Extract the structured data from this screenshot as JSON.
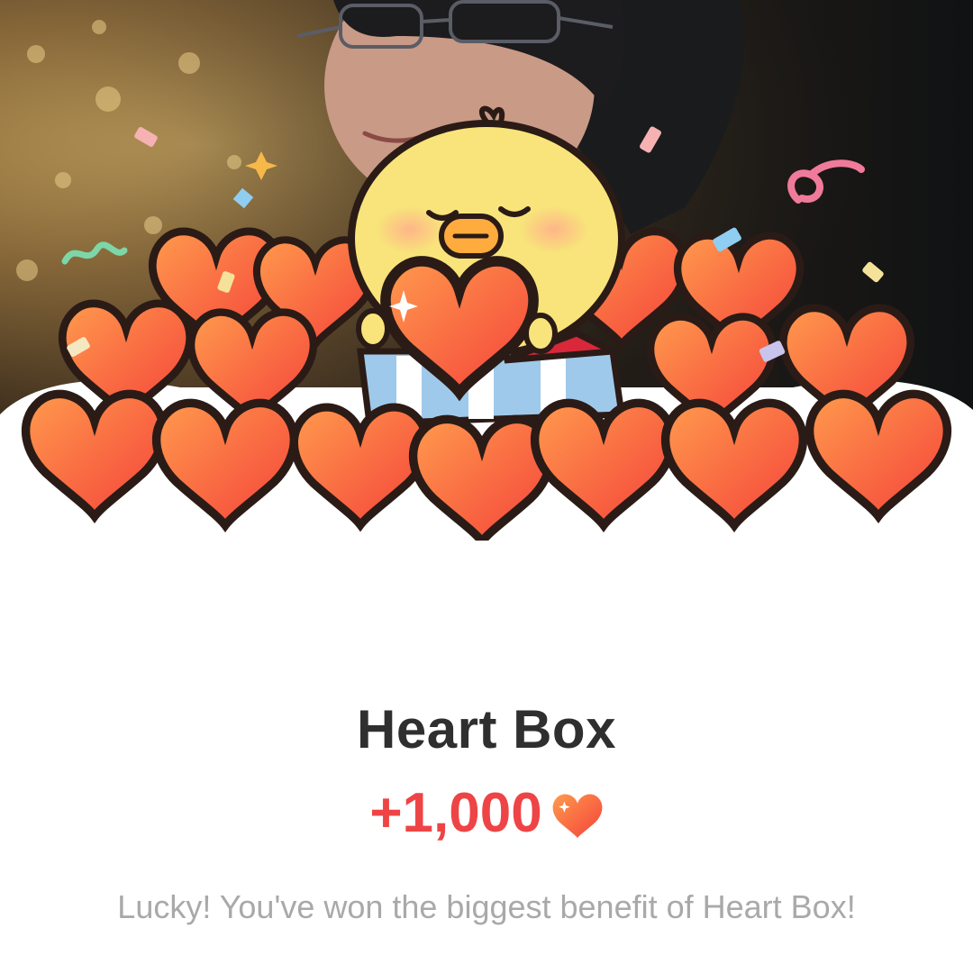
{
  "reward": {
    "title": "Heart Box",
    "amount": "+1,000",
    "currency_icon": "heart-icon",
    "message": "Lucky! You've won the biggest benefit of Heart Box!"
  },
  "colors": {
    "accent_red": "#ee4446",
    "title_text": "#2f2f2f",
    "message_text": "#a9a9a9",
    "heart_light": "#ff9a4d",
    "heart_dark": "#f4423a",
    "chick_yellow": "#f8e47a"
  }
}
